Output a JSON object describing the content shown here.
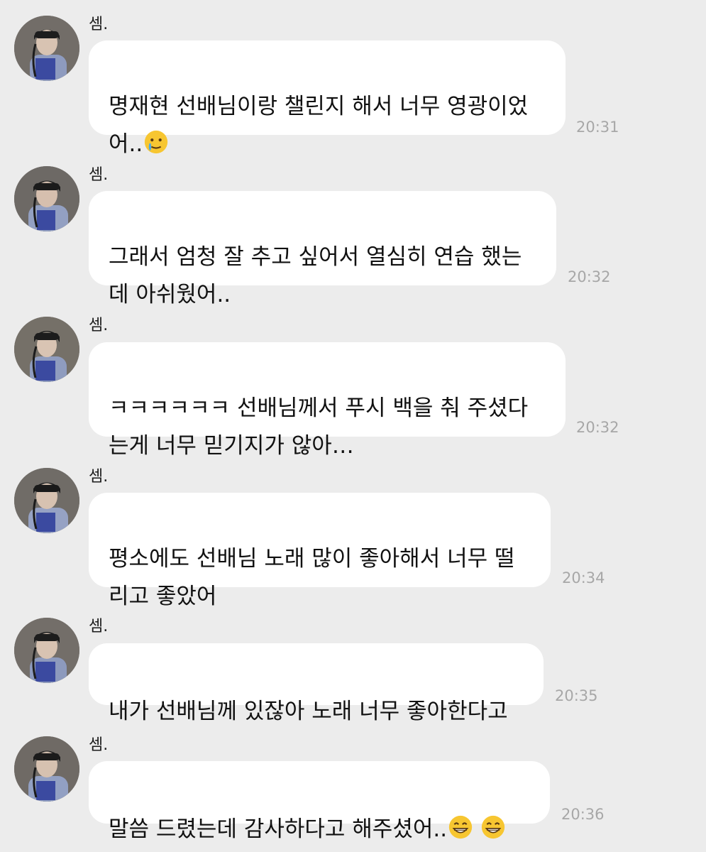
{
  "messages": [
    {
      "sender": "셈.",
      "text": "명재현 선배님이랑 챌린지 해서 너무 영광이었\n어..",
      "emoji": "crying-smile",
      "time": "20:31"
    },
    {
      "sender": "셈.",
      "text": "그래서 엄청 잘 추고 싶어서 열심히 연습 했는\n데 아쉬웠어..",
      "time": "20:32"
    },
    {
      "sender": "셈.",
      "text": "ㅋㅋㅋㅋㅋㅋ 선배님께서 푸시 백을 춰 주셨다\n는게 너무 믿기지가 않아…",
      "time": "20:32"
    },
    {
      "sender": "셈.",
      "text": "평소에도 선배님 노래 많이 좋아해서 너무 떨\n리고 좋았어",
      "time": "20:34"
    },
    {
      "sender": "셈.",
      "text": "내가 선배님께 있잖아 노래 너무 좋아한다고",
      "time": "20:35"
    },
    {
      "sender": "셈.",
      "text": "말씀 드렸는데 감사하다고 해주셨어..",
      "emoji": "grinning-face-x2",
      "time": "20:36"
    }
  ]
}
